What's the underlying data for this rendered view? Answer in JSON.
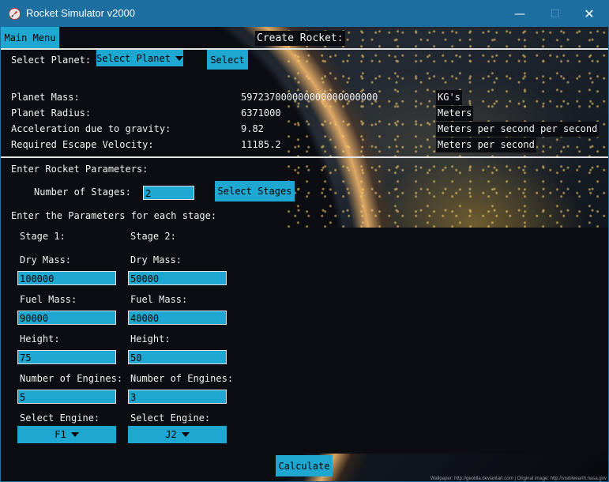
{
  "window": {
    "title": "Rocket Simulator v2000",
    "icons": {
      "app": "rocket-icon",
      "minimize": "minimize-icon",
      "maximize": "maximize-icon",
      "close": "close-icon"
    },
    "controls": {
      "minimize": "—",
      "maximize": "☐",
      "close": "✕"
    }
  },
  "header": {
    "main_menu": "Main Menu",
    "title": "Create Rocket:"
  },
  "planet": {
    "select_label": "Select Planet:",
    "dropdown_value": "Select Planet",
    "select_button": "Select",
    "rows": [
      {
        "label": "Planet Mass:",
        "value": "597237000000000000000000",
        "unit": "KG's"
      },
      {
        "label": "Planet Radius:",
        "value": "6371000",
        "unit": "Meters"
      },
      {
        "label": "Acceleration due to gravity:",
        "value": "9.82",
        "unit": "Meters per second per second"
      },
      {
        "label": "Required Escape Velocity:",
        "value": "11185.2",
        "unit": "Meters per second"
      }
    ]
  },
  "rocket": {
    "heading": "Enter Rocket Parameters:",
    "stages_label": "Number of Stages:",
    "stages_value": "2",
    "select_stages_button": "Select Stages",
    "stage_params_heading": "Enter the Parameters for each stage:"
  },
  "stages": [
    {
      "title": "Stage 1:",
      "dry_mass_label": "Dry Mass:",
      "dry_mass": "100000",
      "fuel_mass_label": "Fuel Mass:",
      "fuel_mass": "90000",
      "height_label": "Height:",
      "height": "75",
      "engines_label": "Number of Engines:",
      "engines": "5",
      "engine_label": "Select Engine:",
      "engine": "F1"
    },
    {
      "title": "Stage 2:",
      "dry_mass_label": "Dry Mass:",
      "dry_mass": "50000",
      "fuel_mass_label": "Fuel Mass:",
      "fuel_mass": "40000",
      "height_label": "Height:",
      "height": "50",
      "engines_label": "Number of Engines:",
      "engines": "3",
      "engine_label": "Select Engine:",
      "engine": "J2"
    }
  ],
  "footer": {
    "calculate_button": "Calculate",
    "credit": "Wallpaper: http://geolilla.deviantart.com | Original image: http://visibleearth.nasa.gov"
  },
  "colors": {
    "accent": "#1ea7d0",
    "titlebar": "#1c6fa0",
    "panel": "#0b0d12",
    "text": "#f2f2f2"
  }
}
